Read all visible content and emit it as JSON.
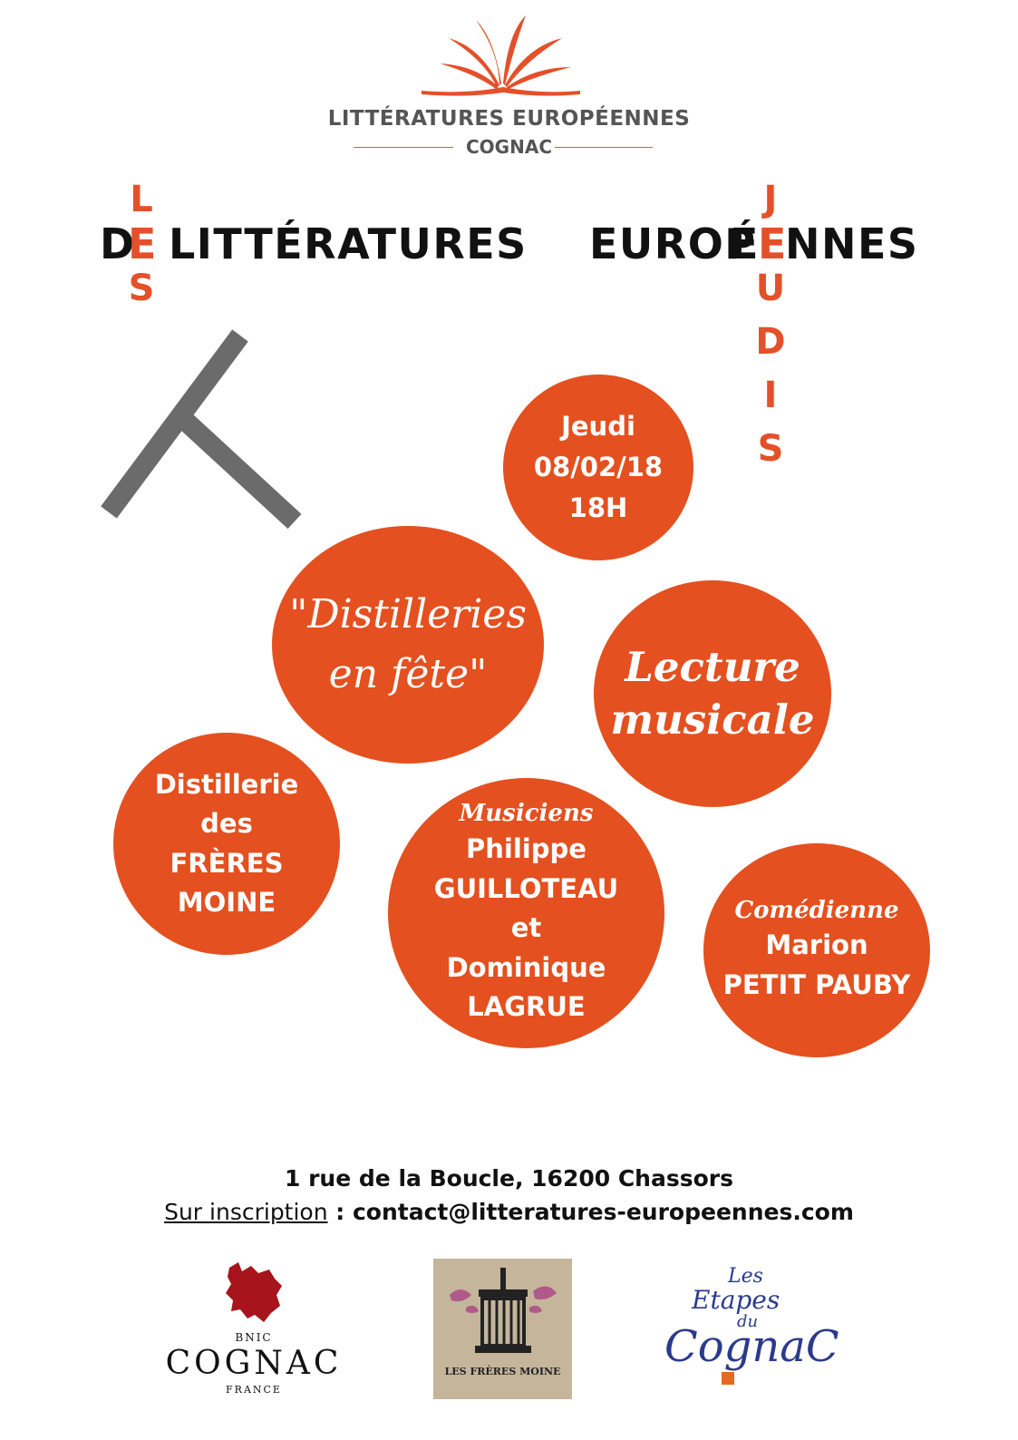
{
  "header": {
    "org_line1": "LITTÉRATURES EUROPÉENNES",
    "org_line2": "COGNAC"
  },
  "crossword": {
    "word1": "D",
    "word1_rest": "LITTÉRATURES",
    "word1_mid": "E",
    "word2_left": "EUROP",
    "word2_mid": "É",
    "word2_right": "NNES",
    "les_top": "L",
    "les_bottom": "S",
    "jeudis_top": "J",
    "jeudis_rest": [
      "U",
      "D",
      "I",
      "S"
    ]
  },
  "date_circle": {
    "day": "Jeudi",
    "date": "08/02/18",
    "time": "18H"
  },
  "title_circle": {
    "line1": "\"Distilleries",
    "line2": "en fête\""
  },
  "lecture_circle": {
    "line1": "Lecture",
    "line2": "musicale"
  },
  "venue_circle": {
    "line1": "Distillerie",
    "line2": "des",
    "line3": "FRÈRES",
    "line4": "MOINE"
  },
  "musicians_circle": {
    "role": "Musiciens",
    "line1": "Philippe",
    "line2": "GUILLOTEAU",
    "line3": "et",
    "line4": "Dominique",
    "line5": "LAGRUE"
  },
  "actress_circle": {
    "role": "Comédienne",
    "line1": "Marion",
    "line2": "PETIT PAUBY"
  },
  "footer": {
    "address": "1 rue de la Boucle, 16200 Chassors",
    "signup_label": "Sur inscription",
    "separator": " : ",
    "email": "contact@litteratures-europeennes.com"
  },
  "logos": {
    "bnic_small": "BNIC",
    "bnic_main": "COGNAC",
    "bnic_country": "FRANCE",
    "freres_moine": "LES FRÈRES MOINE",
    "etapes_les": "Les",
    "etapes_mid": "Etapes",
    "etapes_du": "du",
    "etapes_main": "CognaC"
  },
  "colors": {
    "accent": "#e4501f",
    "grey": "#666666"
  }
}
